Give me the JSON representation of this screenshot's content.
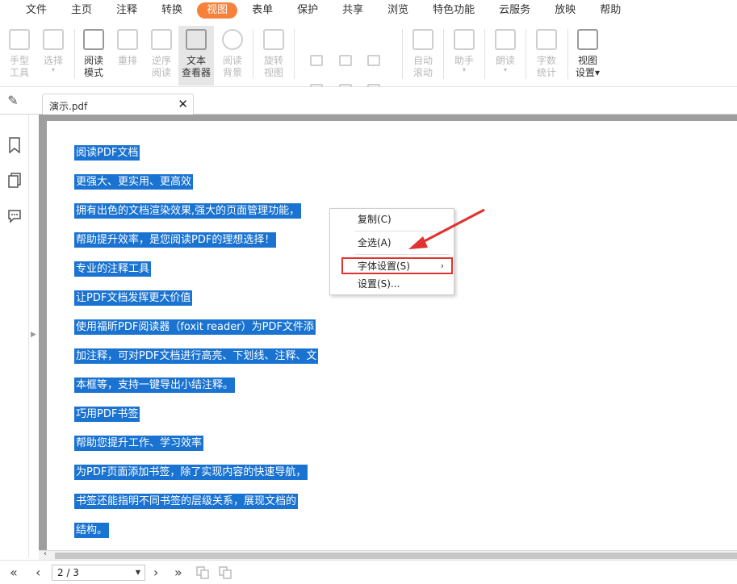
{
  "menubar": {
    "items": [
      "文件",
      "主页",
      "注释",
      "转换",
      "视图",
      "表单",
      "保护",
      "共享",
      "浏览",
      "特色功能",
      "云服务",
      "放映",
      "帮助"
    ],
    "active_index": 4,
    "accent": "#f5813a"
  },
  "ribbon": {
    "hand_tool": "手型\n工具",
    "select": "选择",
    "read_mode": "阅读\n模式",
    "reflow": "重排",
    "reverse_read": "逆序\n阅读",
    "text_viewer": "文本\n查看器",
    "read_bg": "阅读\n背景",
    "rotate_view": "旋转\n视图",
    "auto_scroll": "自动\n滚动",
    "assistant": "助手",
    "read_aloud": "朗读",
    "word_count": "字数\n统计",
    "view_settings": "视图\n设置"
  },
  "tab": {
    "filename": "演示.pdf",
    "close": "✕"
  },
  "document": {
    "selection_color": "#1a73d1",
    "lines": [
      "阅读PDF文档",
      "更强大、更实用、更高效",
      "拥有出色的文档渲染效果,强大的页面管理功能，",
      "帮助提升效率，是您阅读PDF的理想选择！",
      "专业的注释工具",
      "让PDF文档发挥更大价值",
      "使用福昕PDF阅读器（foxit reader）为PDF文件添",
      "加注释，可对PDF文档进行高亮、下划线、注释、文",
      "本框等，支持一键导出小结注释。",
      "巧用PDF书签",
      "帮助您提升工作、学习效率",
      "为PDF页面添加书签，除了实现内容的快速导航，",
      "书签还能指明不同书签的层级关系，展现文档的",
      "结构。"
    ]
  },
  "context_menu": {
    "copy": "复制(C)",
    "select_all": "全选(A)",
    "font_settings": "字体设置(S)",
    "settings": "设置(S)...",
    "submenu_arrow": "›",
    "highlight_color": "#e0322e"
  },
  "statusbar": {
    "page_value": "2 / 3",
    "first": "«",
    "prev": "‹",
    "next": "›",
    "last": "»"
  }
}
